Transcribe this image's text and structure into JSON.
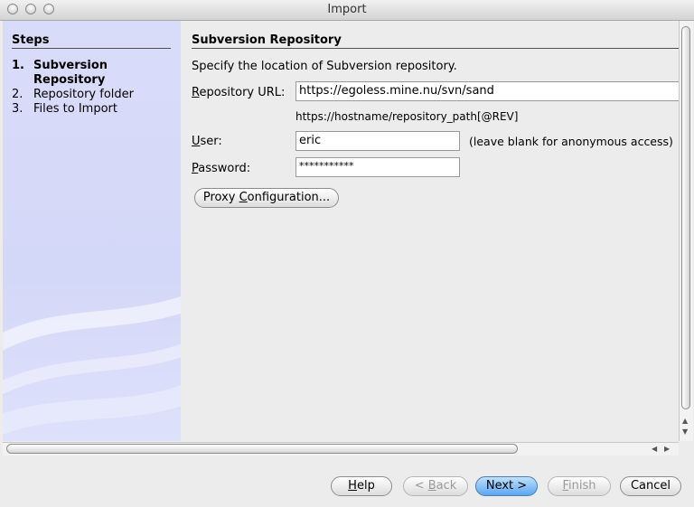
{
  "window": {
    "title": "Import"
  },
  "steps": {
    "heading": "Steps",
    "items": [
      {
        "num": "1.",
        "label": "Subversion Repository",
        "active": true
      },
      {
        "num": "2.",
        "label": "Repository folder",
        "active": false
      },
      {
        "num": "3.",
        "label": "Files to Import",
        "active": false
      }
    ]
  },
  "panel": {
    "heading": "Subversion Repository",
    "description": "Specify the location of Subversion repository.",
    "repo_url": {
      "label_first": "R",
      "label_rest": "epository URL:",
      "value": "https://egoless.mine.nu/svn/sand",
      "format_hint": "https://hostname/repository_path[@REV]"
    },
    "user": {
      "label_first": "U",
      "label_rest": "ser:",
      "value": "eric",
      "hint": "(leave blank for anonymous access)"
    },
    "password": {
      "label_first": "P",
      "label_rest": "assword:",
      "value": "***********"
    },
    "proxy_button": {
      "pre": "Proxy ",
      "mnemonic": "C",
      "post": "onfiguration..."
    }
  },
  "buttons": {
    "help": {
      "mnemonic": "H",
      "rest": "elp"
    },
    "back": {
      "pre": "< ",
      "mnemonic": "B",
      "rest": "ack"
    },
    "next": "Next >",
    "finish": {
      "mnemonic": "F",
      "rest": "inish"
    },
    "cancel": "Cancel"
  },
  "colors": {
    "steps_bg": "#d6daf8",
    "default_button": "#5aa6f0"
  }
}
